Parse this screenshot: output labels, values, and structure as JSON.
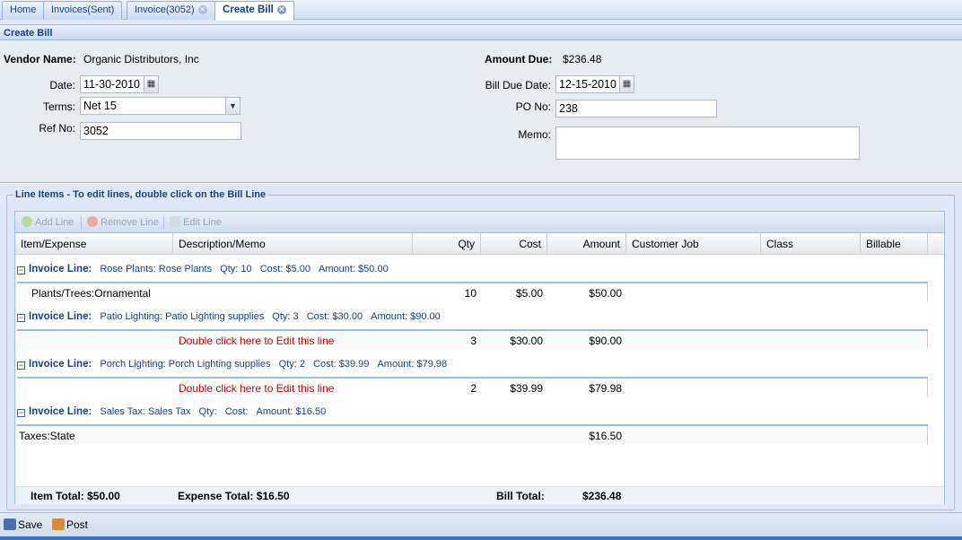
{
  "tabs": [
    {
      "label": "Home"
    },
    {
      "label": "Invoices(Sent)"
    },
    {
      "label": "Invoice(3052)"
    },
    {
      "label": "Create Bill"
    }
  ],
  "panel": {
    "title": "Create Bill"
  },
  "form": {
    "vendor_label": "Vendor Name:",
    "vendor_value": "Organic Distributors, Inc",
    "date_label": "Date:",
    "date_value": "11-30-2010",
    "terms_label": "Terms:",
    "terms_value": "Net 15",
    "ref_label": "Ref No:",
    "ref_value": "3052",
    "amount_due_label": "Amount Due:",
    "amount_due_value": "$236.48",
    "due_date_label": "Bill Due Date:",
    "due_date_value": "12-15-2010",
    "po_label": "PO No:",
    "po_value": "238",
    "memo_label": "Memo:",
    "memo_value": ""
  },
  "line_items": {
    "legend": "Line Items - To edit lines, double click on the Bill Line",
    "toolbar": {
      "add": "Add Line",
      "remove": "Remove Line",
      "edit": "Edit Line"
    },
    "columns": [
      "Item/Expense",
      "Description/Memo",
      "Qty",
      "Cost",
      "Amount",
      "Customer Job",
      "Class",
      "Billable"
    ],
    "groups": [
      {
        "label": "Invoice Line:",
        "summary": "Rose Plants: Rose Plants",
        "qty": "Qty: 10",
        "cost": "Cost: $5.00",
        "amount": "Amount: $50.00",
        "row": {
          "item": "Plants/Trees:Ornamental",
          "desc": "",
          "qty": "10",
          "cost": "$5.00",
          "amount": "$50.00"
        }
      },
      {
        "label": "Invoice Line:",
        "summary": "Patio Lighting: Patio Lighting supplies",
        "qty": "Qty: 3",
        "cost": "Cost: $30.00",
        "amount": "Amount: $90.00",
        "row": {
          "item": "",
          "desc": "Double click here to Edit this line",
          "qty": "3",
          "cost": "$30.00",
          "amount": "$90.00"
        }
      },
      {
        "label": "Invoice Line:",
        "summary": "Porch Lighting: Porch Lighting supplies",
        "qty": "Qty: 2",
        "cost": "Cost: $39.99",
        "amount": "Amount: $79.98",
        "row": {
          "item": "",
          "desc": "Double click here to Edit this line",
          "qty": "2",
          "cost": "$39.99",
          "amount": "$79.98"
        }
      },
      {
        "label": "Invoice Line:",
        "summary": "Sales Tax: Sales Tax",
        "qty": "Qty:",
        "cost": "Cost:",
        "amount": "Amount: $16.50",
        "row": {
          "item": "Taxes:State",
          "desc": "",
          "qty": "",
          "cost": "",
          "amount": "$16.50"
        }
      }
    ],
    "totals": {
      "item_total": "Item Total: $50.00",
      "expense_total": "Expense Total: $16.50",
      "bill_total_label": "Bill Total:",
      "bill_total_value": "$236.48"
    }
  },
  "footer": {
    "save": "Save",
    "post": "Post"
  },
  "colors": {
    "accent": "#15428b",
    "edit_hint": "#cc0000",
    "border": "#99bbe8"
  }
}
